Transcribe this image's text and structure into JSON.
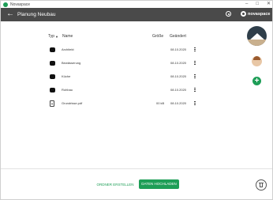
{
  "window": {
    "title": "Novaspace"
  },
  "appbar": {
    "title": "Planung Neubau",
    "brand": "novaspace"
  },
  "table": {
    "headers": {
      "type": "Typ",
      "name": "Name",
      "size": "Größe",
      "date": "Geändert"
    },
    "rows": [
      {
        "kind": "folder",
        "name": "Architekt",
        "size": "",
        "date": "08.10.2020"
      },
      {
        "kind": "folder",
        "name": "Bewässerung",
        "size": "",
        "date": "08.10.2020"
      },
      {
        "kind": "folder",
        "name": "Küche",
        "size": "",
        "date": "08.10.2020"
      },
      {
        "kind": "folder",
        "name": "Rohbau",
        "size": "",
        "date": "08.10.2020"
      },
      {
        "kind": "file",
        "name": "Grundrisse.pdf",
        "size": "00 kB",
        "date": "08.10.2020"
      }
    ]
  },
  "actions": {
    "create_folder": "ORDNER ERSTELLEN",
    "upload": "DATEN HOCHLADEN"
  },
  "colors": {
    "accent": "#1e9e57",
    "appbar": "#4a4a4a"
  }
}
